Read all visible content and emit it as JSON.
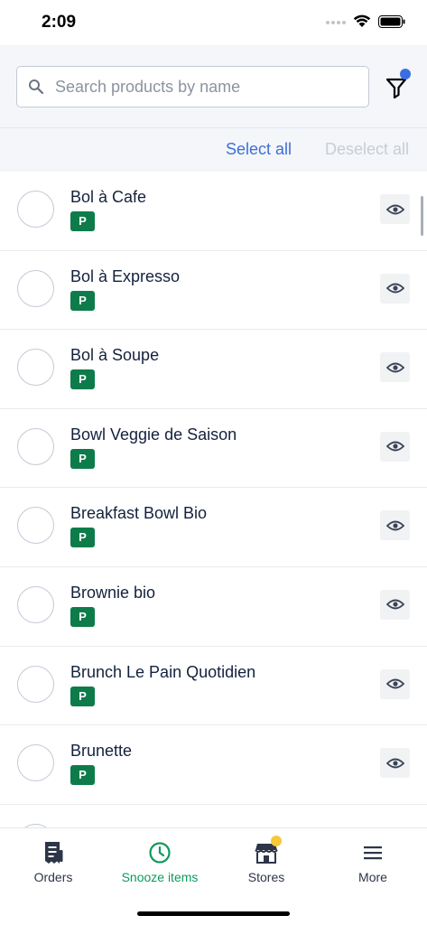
{
  "status_bar": {
    "time": "2:09"
  },
  "search": {
    "placeholder": "Search products by name",
    "value": ""
  },
  "actions": {
    "select_all": "Select all",
    "deselect_all": "Deselect all"
  },
  "products": [
    {
      "name": "Bol à Cafe",
      "badge": "P"
    },
    {
      "name": "Bol à Expresso",
      "badge": "P"
    },
    {
      "name": "Bol à Soupe",
      "badge": "P"
    },
    {
      "name": "Bowl Veggie de Saison",
      "badge": "P"
    },
    {
      "name": "Breakfast Bowl Bio",
      "badge": "P"
    },
    {
      "name": "Brownie bio",
      "badge": "P"
    },
    {
      "name": "Brunch Le Pain Quotidien",
      "badge": "P"
    },
    {
      "name": "Brunette",
      "badge": "P"
    }
  ],
  "tabs": [
    {
      "label": "Orders",
      "icon": "orders-icon"
    },
    {
      "label": "Snooze items",
      "icon": "clock-icon"
    },
    {
      "label": "Stores",
      "icon": "store-icon"
    },
    {
      "label": "More",
      "icon": "menu-icon"
    }
  ],
  "colors": {
    "accent": "#3d6fd6",
    "badge": "#0e7c4a",
    "active_tab": "#0e9a5c",
    "notification": "#f6c83a"
  }
}
